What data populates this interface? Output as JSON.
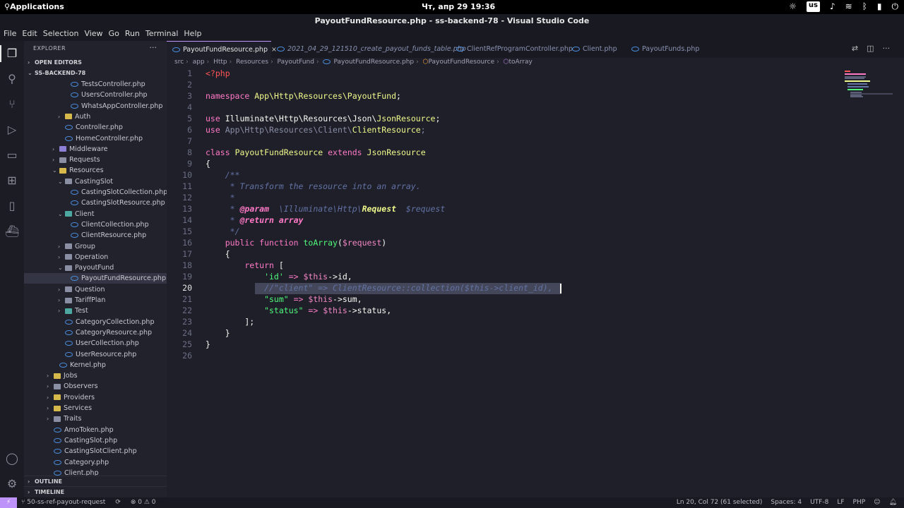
{
  "os": {
    "apps_label": "Applications",
    "clock": "Чт, апр 29   19:36",
    "kbd_layout": "us",
    "tray_icons": [
      "brightness-icon",
      "keyboard-layout",
      "volume-icon",
      "wifi-icon",
      "bluetooth-icon",
      "battery-icon",
      "power-icon"
    ]
  },
  "window": {
    "title": "PayoutFundResource.php - ss-backend-78 - Visual Studio Code"
  },
  "menu": [
    "File",
    "Edit",
    "Selection",
    "View",
    "Go",
    "Run",
    "Terminal",
    "Help"
  ],
  "activity_icons": [
    "explorer-icon",
    "search-icon",
    "source-control-icon",
    "run-debug-icon",
    "remote-explorer-icon",
    "extensions-icon",
    "notebook-icon",
    "docker-icon",
    "account-icon",
    "settings-gear-icon"
  ],
  "sidebar": {
    "title": "EXPLORER",
    "more": "···",
    "open_editors": "OPEN EDITORS",
    "project": "SS-BACKEND-78",
    "items": [
      {
        "label": "TestsController.php",
        "type": "php",
        "depth": 6
      },
      {
        "label": "UsersController.php",
        "type": "php",
        "depth": 6
      },
      {
        "label": "WhatsAppController.php",
        "type": "php",
        "depth": 6
      },
      {
        "label": "Auth",
        "type": "folder-yellow",
        "depth": 5,
        "chev": "›"
      },
      {
        "label": "Controller.php",
        "type": "php",
        "depth": 5
      },
      {
        "label": "HomeController.php",
        "type": "php",
        "depth": 5
      },
      {
        "label": "Middleware",
        "type": "folder-purple",
        "depth": 4,
        "chev": "›"
      },
      {
        "label": "Requests",
        "type": "folder",
        "depth": 4,
        "chev": "›"
      },
      {
        "label": "Resources",
        "type": "folder-yellow",
        "depth": 4,
        "chev": "⌄"
      },
      {
        "label": "CastingSlot",
        "type": "folder",
        "depth": 5,
        "chev": "⌄"
      },
      {
        "label": "CastingSlotCollection.php",
        "type": "php",
        "depth": 6
      },
      {
        "label": "CastingSlotResource.php",
        "type": "php",
        "depth": 6
      },
      {
        "label": "Client",
        "type": "folder-teal",
        "depth": 5,
        "chev": "⌄"
      },
      {
        "label": "ClientCollection.php",
        "type": "php",
        "depth": 6
      },
      {
        "label": "ClientResource.php",
        "type": "php",
        "depth": 6
      },
      {
        "label": "Group",
        "type": "folder",
        "depth": 5,
        "chev": "›"
      },
      {
        "label": "Operation",
        "type": "folder",
        "depth": 5,
        "chev": "›"
      },
      {
        "label": "PayoutFund",
        "type": "folder",
        "depth": 5,
        "chev": "⌄"
      },
      {
        "label": "PayoutFundResource.php",
        "type": "php",
        "depth": 6,
        "selected": true
      },
      {
        "label": "Question",
        "type": "folder",
        "depth": 5,
        "chev": "›"
      },
      {
        "label": "TariffPlan",
        "type": "folder",
        "depth": 5,
        "chev": "›"
      },
      {
        "label": "Test",
        "type": "folder-teal",
        "depth": 5,
        "chev": "›"
      },
      {
        "label": "CategoryCollection.php",
        "type": "php",
        "depth": 5
      },
      {
        "label": "CategoryResource.php",
        "type": "php",
        "depth": 5
      },
      {
        "label": "UserCollection.php",
        "type": "php",
        "depth": 5
      },
      {
        "label": "UserResource.php",
        "type": "php",
        "depth": 5
      },
      {
        "label": "Kernel.php",
        "type": "php",
        "depth": 4
      },
      {
        "label": "Jobs",
        "type": "folder-yellow",
        "depth": 3,
        "chev": "›"
      },
      {
        "label": "Observers",
        "type": "folder",
        "depth": 3,
        "chev": "›"
      },
      {
        "label": "Providers",
        "type": "folder-yellow",
        "depth": 3,
        "chev": "›"
      },
      {
        "label": "Services",
        "type": "folder-yellow",
        "depth": 3,
        "chev": "›"
      },
      {
        "label": "Traits",
        "type": "folder",
        "depth": 3,
        "chev": "›"
      },
      {
        "label": "AmoToken.php",
        "type": "php",
        "depth": 3
      },
      {
        "label": "CastingSlot.php",
        "type": "php",
        "depth": 3
      },
      {
        "label": "CastingSlotClient.php",
        "type": "php",
        "depth": 3
      },
      {
        "label": "Category.php",
        "type": "php",
        "depth": 3
      },
      {
        "label": "Client.php",
        "type": "php",
        "depth": 3
      }
    ],
    "outline": "OUTLINE",
    "timeline": "TIMELINE"
  },
  "tabs": [
    {
      "label": "PayoutFundResource.php",
      "active": true,
      "close": "×"
    },
    {
      "label": "2021_04_29_121510_create_payout_funds_table.php",
      "italic": true
    },
    {
      "label": "ClientRefProgramController.php"
    },
    {
      "label": "Client.php"
    },
    {
      "label": "PayoutFunds.php"
    }
  ],
  "breadcrumb": [
    "src",
    "app",
    "Http",
    "Resources",
    "PayoutFund",
    "PayoutFundResource.php",
    "PayoutFundResource",
    "toArray"
  ],
  "code_lines": [
    {
      "n": "1"
    },
    {
      "n": "2"
    },
    {
      "n": "3"
    },
    {
      "n": "4"
    },
    {
      "n": "5"
    },
    {
      "n": "6"
    },
    {
      "n": "7"
    },
    {
      "n": "8"
    },
    {
      "n": "9"
    },
    {
      "n": "10"
    },
    {
      "n": "11"
    },
    {
      "n": "12"
    },
    {
      "n": "13"
    },
    {
      "n": "14"
    },
    {
      "n": "15"
    },
    {
      "n": "16"
    },
    {
      "n": "17"
    },
    {
      "n": "18"
    },
    {
      "n": "19"
    },
    {
      "n": "20"
    },
    {
      "n": "21"
    },
    {
      "n": "22"
    },
    {
      "n": "23"
    },
    {
      "n": "24"
    },
    {
      "n": "25"
    },
    {
      "n": "26"
    }
  ],
  "code": {
    "l1": "<?php",
    "l3_kw": "namespace",
    "l3_ns": "App\\Http\\Resources\\PayoutFund",
    "l3_end": ";",
    "l5_kw": "use",
    "l5_ns": "Illuminate\\Http\\Resources\\Json\\",
    "l5_cls": "JsonResource",
    "l5_end": ";",
    "l6_kw": "use",
    "l6_ns": "App\\Http\\Resources\\Client\\",
    "l6_cls": "ClientResource",
    "l6_end": ";",
    "l8_kw": "class",
    "l8_cls": "PayoutFundResource",
    "l8_kw2": "extends",
    "l8_cls2": "JsonResource",
    "l9": "{",
    "l10": "    /**",
    "l11": "     * Transform the resource into an array.",
    "l12": "     *",
    "l13_a": "     * ",
    "l13_ann": "@param",
    "l13_b": "  \\Illuminate\\Http\\",
    "l13_cls": "Request",
    "l13_c": "  $request",
    "l14_a": "     * ",
    "l14_ann": "@return",
    "l14_b": " array",
    "l15": "     */",
    "l16_kw": "    public function ",
    "l16_fn": "toArray",
    "l16_p": "(",
    "l16_var": "$request",
    "l16_end": ")",
    "l17": "    {",
    "l18_kw": "        return",
    "l18_end": " [",
    "l19_str": "            'id'",
    "l19_op": " => ",
    "l19_var": "$this",
    "l19_rest": "->id,",
    "l20": "            //\"client\" => ClientResource::collection($this->client_id),",
    "l21_str": "            \"sum\"",
    "l21_op": " => ",
    "l21_var": "$this",
    "l21_rest": "->sum,",
    "l22_str": "            \"status\"",
    "l22_op": " => ",
    "l22_var": "$this",
    "l22_rest": "->status,",
    "l23": "        ];",
    "l24": "    }",
    "l25": "}"
  },
  "status": {
    "branch": "50-ss-ref-payout-request",
    "sync": "⟳",
    "problems": "⊗ 0 ⚠ 0",
    "position": "Ln 20, Col 72 (61 selected)",
    "spaces": "Spaces: 4",
    "encoding": "UTF-8",
    "eol": "LF",
    "language": "PHP",
    "feedback_icon": "feedback-icon",
    "bell_icon": "bell-icon"
  },
  "colors": {
    "accent": "#bd93f9",
    "bg": "#1e1f29",
    "sidebar": "#21222c"
  }
}
